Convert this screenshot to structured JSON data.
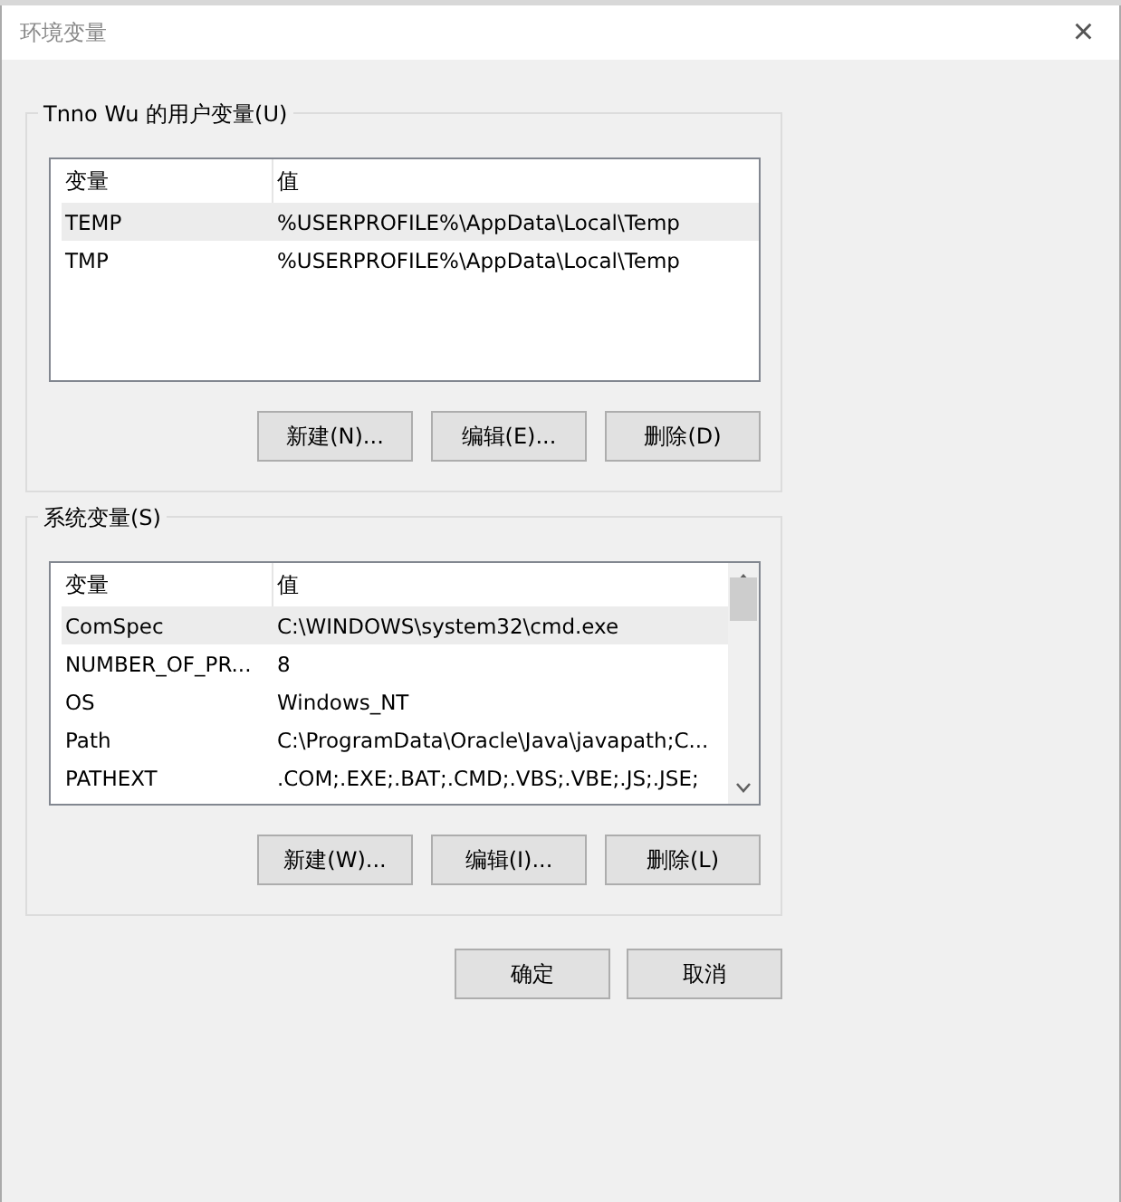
{
  "window": {
    "title": "环境变量",
    "close": "×"
  },
  "user_vars": {
    "title": "Tnno Wu 的用户变量(U)",
    "columns": [
      "变量",
      "值"
    ],
    "rows": [
      {
        "name": "TEMP",
        "value": "%USERPROFILE%\\AppData\\Local\\Temp",
        "selected": true
      },
      {
        "name": "TMP",
        "value": "%USERPROFILE%\\AppData\\Local\\Temp",
        "selected": false
      }
    ],
    "buttons": [
      "新建(N)...",
      "编辑(E)...",
      "删除(D)"
    ]
  },
  "system_vars": {
    "title": "系统变量(S)",
    "columns": [
      "变量",
      "值"
    ],
    "rows": [
      {
        "name": "ComSpec",
        "value": "C:\\WINDOWS\\system32\\cmd.exe",
        "selected": true
      },
      {
        "name": "NUMBER_OF_PR...",
        "value": "8",
        "selected": false
      },
      {
        "name": "OS",
        "value": "Windows_NT",
        "selected": false
      },
      {
        "name": "Path",
        "value": "C:\\ProgramData\\Oracle\\Java\\javapath;C...",
        "selected": false
      },
      {
        "name": "PATHEXT",
        "value": ".COM;.EXE;.BAT;.CMD;.VBS;.VBE;.JS;.JSE;",
        "selected": false
      }
    ],
    "scrollbar": true,
    "buttons": [
      "新建(W)...",
      "编辑(I)...",
      "删除(L)"
    ]
  },
  "footer_buttons": [
    "确定",
    "取消"
  ]
}
